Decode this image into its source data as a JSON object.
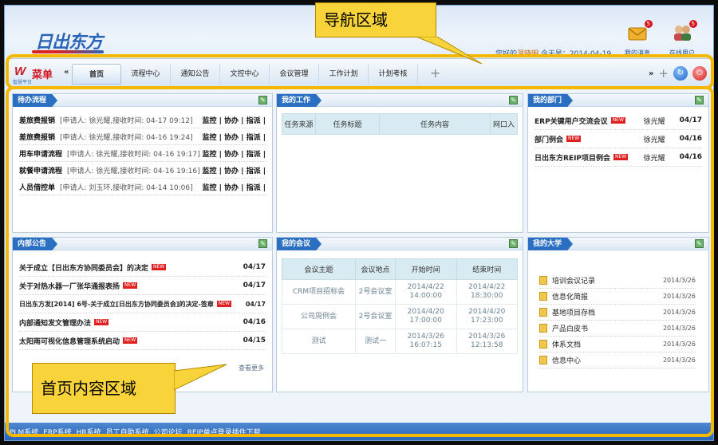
{
  "header": {
    "logo_text": "日出东方",
    "welcome_prefix": "您好的",
    "user_name": "温晓明",
    "welcome_mid": " 今天是：",
    "date": "2014-04-19",
    "icons": [
      {
        "label": "我的消息",
        "badge": "5",
        "icon": "envelope-icon"
      },
      {
        "label": "在线用户",
        "badge": "5",
        "icon": "users-icon"
      }
    ]
  },
  "nav": {
    "brand_mark": "W",
    "brand_sub": "智慧平台",
    "menu_label": "菜单",
    "tabs": [
      {
        "label": "首页",
        "active": true
      },
      {
        "label": "流程中心"
      },
      {
        "label": "通知公告"
      },
      {
        "label": "文控中心"
      },
      {
        "label": "会议管理"
      },
      {
        "label": "工作计划"
      },
      {
        "label": "计划考核"
      }
    ],
    "left_arrow": "«",
    "right_arrow": "»",
    "plus": "+"
  },
  "todo": {
    "title": "待办流程",
    "rows": [
      {
        "title": "差旅费报销",
        "meta": "[申请人: 徐光耀,接收时间: 04-17 09:12]",
        "actions": "监控 | 协办 | 指派 |"
      },
      {
        "title": "差旅费报销",
        "meta": "[申请人: 徐光耀,接收时间: 04-16 19:24]",
        "actions": "监控 | 协办 | 指派 |"
      },
      {
        "title": "用车申请流程",
        "meta": "[申请人: 徐光耀,接收时间: 04-16 19:17]",
        "actions": "监控 | 协办 | 指派 |"
      },
      {
        "title": "就餐申请流程",
        "meta": "[申请人: 徐光耀,接收时间: 04-16 19:16]",
        "actions": "监控 | 协办 | 指派 |"
      },
      {
        "title": "人员借控单",
        "meta": "[申请人: 刘玉环,接收时间: 04-14 10:06]",
        "actions": "监控 | 协办 | 指派 |"
      }
    ]
  },
  "work": {
    "title": "我的工作",
    "headers": [
      "任务来源",
      "任务标题",
      "任务内容",
      "网口入"
    ]
  },
  "dept": {
    "title": "我的部门",
    "rows": [
      {
        "title": "ERP关键用户交流会议",
        "new": "NEW",
        "person": "徐光耀",
        "date": "04/17"
      },
      {
        "title": "部门例会",
        "new": "NEW",
        "person": "徐光耀",
        "date": "04/16"
      },
      {
        "title": "日出东方REIP项目例会",
        "new": "NEW",
        "person": "徐光耀",
        "date": "04/16"
      }
    ]
  },
  "notice": {
    "title": "内部公告",
    "rows": [
      {
        "title": "关于成立【日出东方协同委员会】的决定",
        "new": "NEW",
        "date": "04/17"
      },
      {
        "title": "关于对热水器一厂张华通报表扬",
        "new": "NEW",
        "date": "04/17"
      },
      {
        "title": "日出东方发[2014] 6号-关于成立[日出东方协同委员会]的决定-签章",
        "new": "NEW",
        "date": "04/17"
      },
      {
        "title": "内部通知发文管理办法",
        "new": "NEW",
        "date": "04/16"
      },
      {
        "title": "太阳雨可视化信息管理系统启动",
        "new": "NEW",
        "date": "04/15"
      }
    ],
    "more": "查看更多"
  },
  "meeting": {
    "title": "我的会议",
    "headers": [
      "会议主题",
      "会议地点",
      "开始时间",
      "结束时间"
    ],
    "rows": [
      {
        "topic": "CRM项目招标会",
        "place": "2号会议室",
        "start": "2014/4/22 14:00:00",
        "end": "2014/4/22 18:30:00"
      },
      {
        "topic": "公司周例会",
        "place": "2号会议室",
        "start": "2014/4/20 17:00:00",
        "end": "2014/4/20 17:23:00"
      },
      {
        "topic": "测试",
        "place": "测试一",
        "start": "2014/3/26 16:07:15",
        "end": "2014/3/26 12:13:58"
      }
    ]
  },
  "univ": {
    "title": "我的大学",
    "rows": [
      {
        "name": "培训会议记录",
        "date": "2014/3/26"
      },
      {
        "name": "信息化简报",
        "date": "2014/3/26"
      },
      {
        "name": "基地项目存档",
        "date": "2014/3/26"
      },
      {
        "name": "产品白皮书",
        "date": "2014/3/26"
      },
      {
        "name": "体系文档",
        "date": "2014/3/26"
      },
      {
        "name": "信息中心",
        "date": "2014/3/26"
      }
    ]
  },
  "footer": {
    "links": [
      "PLM系统",
      "ERP系统",
      "HR系统",
      "员工自助系统",
      "公司论坛",
      "REIP单点登录插件下载"
    ]
  },
  "annotations": {
    "nav_area": "导航区域",
    "content_area": "首页内容区域",
    "outline_color": "#f5b800",
    "callout_color": "#f9d33a"
  }
}
